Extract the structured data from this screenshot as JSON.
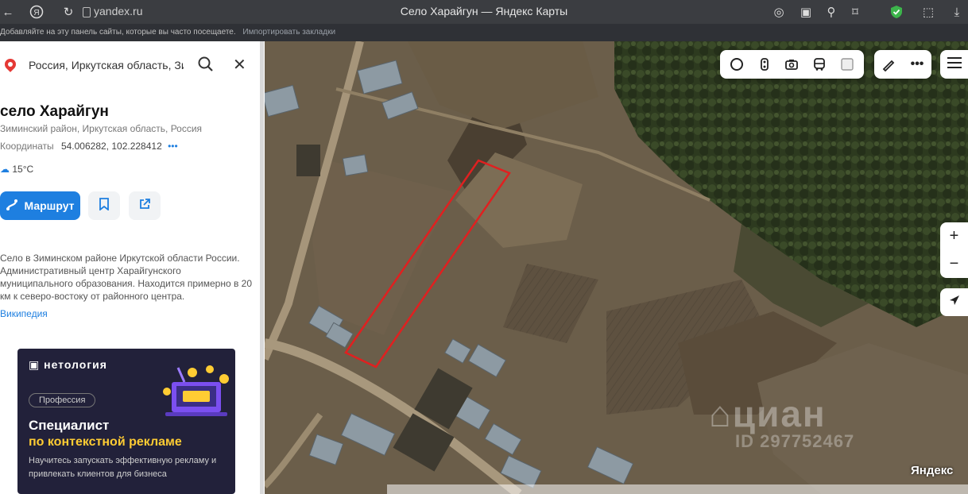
{
  "browser": {
    "url": "yandex.ru",
    "window_title": "Село Харайгун — Яндекс Карты",
    "bookmarks_hint": "Добавляйте на эту панель сайты, которые вы часто посещаете.",
    "bookmarks_import": "Импортировать закладки"
  },
  "search": {
    "value": "Россия, Иркутская область, Зим"
  },
  "place": {
    "title": "село Харайгун",
    "subtitle": "Зиминский район, Иркутская область, Россия",
    "coords_label": "Координаты",
    "coords_value": "54.006282, 102.228412",
    "temperature": "15°C",
    "route_label": "Маршрут",
    "description": "Село в Зиминском районе Иркутской области России. Административный центр Харайгунского муниципального образования. Находится примерно в 20 км к северо-востоку от районного центра.",
    "wiki_link": "Википедия"
  },
  "ad": {
    "brand": "нетология",
    "badge": "Профессия",
    "headline": "Специалист",
    "headline2": "по контекстной рекламе",
    "text": "Научитесь запускать эффективную рекламу и привлекать клиентов для бизнеса"
  },
  "map": {
    "watermark": "циан",
    "watermark_id": "ID 297752467",
    "provider": "Яндекс",
    "plot_outline_color": "#e02020",
    "accent": "#1e7fe0"
  }
}
